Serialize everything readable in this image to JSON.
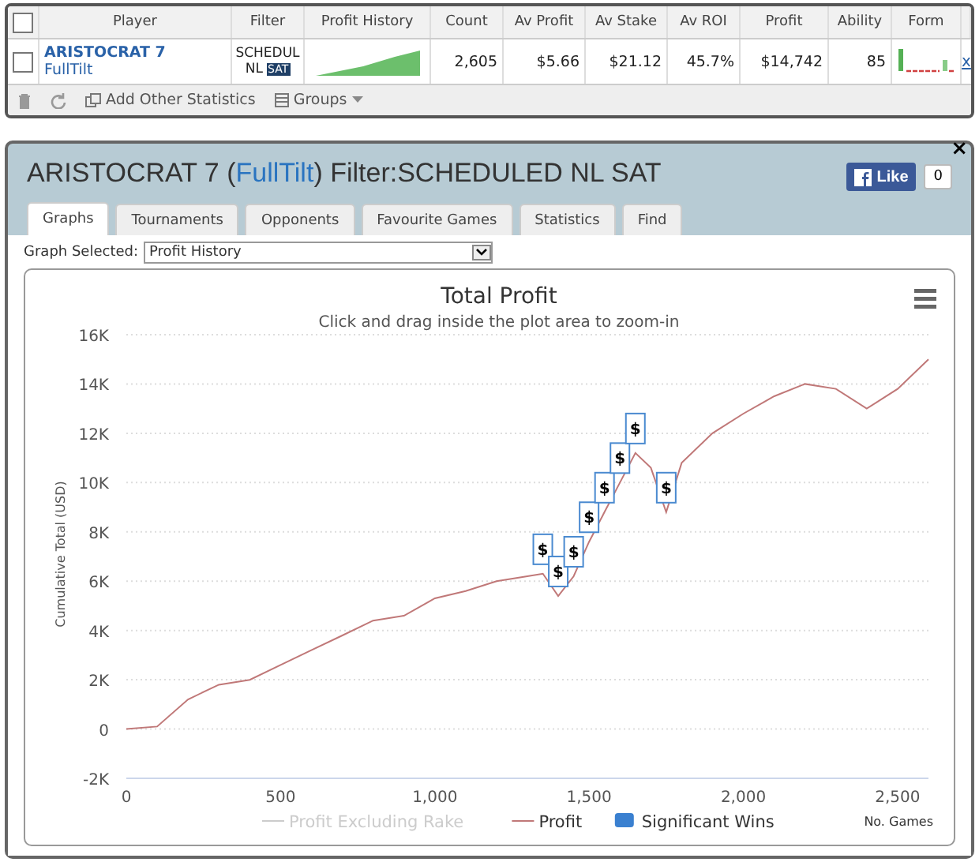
{
  "players_table": {
    "columns": [
      "Player",
      "Filter",
      "Profit History",
      "Count",
      "Av Profit",
      "Av Stake",
      "Av ROI",
      "Profit",
      "Ability",
      "Form"
    ],
    "header_checked": false,
    "rows": [
      {
        "checked": false,
        "player": "ARISTOCRAT 7",
        "site": "FullTilt",
        "filter_lines": [
          "SCHEDUL",
          "NL"
        ],
        "filter_badge": "SAT",
        "count": "2,605",
        "av_profit": "$5.66",
        "av_stake": "$21.12",
        "av_roi": "45.7%",
        "profit": "$14,742",
        "ability": "85",
        "remove": "x"
      }
    ],
    "toolbar": {
      "add_statistics": "Add Other Statistics",
      "groups": "Groups"
    }
  },
  "panel": {
    "title_before": "ARISTOCRAT 7 (",
    "title_link": "FullTilt",
    "title_after": ") Filter:SCHEDULED NL SAT",
    "like": "Like",
    "like_count": "0",
    "close": "×",
    "tabs": [
      {
        "label": "Graphs",
        "selected": true
      },
      {
        "label": "Tournaments",
        "selected": false
      },
      {
        "label": "Opponents",
        "selected": false
      },
      {
        "label": "Favourite Games",
        "selected": false
      },
      {
        "label": "Statistics",
        "selected": false
      },
      {
        "label": "Find",
        "selected": false
      }
    ],
    "graph_select": {
      "label": "Graph Selected:",
      "value": "Profit History"
    },
    "chart": {
      "legend": [
        {
          "label": "Profit Excluding Rake",
          "enabled": false,
          "kind": "line"
        },
        {
          "kind": "series",
          "enabled": true
        },
        {
          "label": "Significant Wins",
          "enabled": true,
          "kind": "flag",
          "color": "#3a80d0"
        }
      ],
      "chart_data": {
        "type": "line",
        "title": "Total Profit",
        "subtitle": "Click and drag inside the plot area to zoom-in",
        "xlabel": "No. Games",
        "ylabel": "Cumulative Total (USD)",
        "grid": true,
        "x": [
          0,
          100,
          200,
          300,
          400,
          500,
          600,
          700,
          800,
          900,
          1000,
          1100,
          1200,
          1300,
          1350,
          1400,
          1450,
          1500,
          1550,
          1600,
          1650,
          1700,
          1750,
          1800,
          1900,
          2000,
          2100,
          2200,
          2300,
          2400,
          2450,
          2500,
          2600
        ],
        "series": [
          {
            "name": "Profit",
            "color": "#c07878",
            "values": [
              0,
              100,
              1200,
              1800,
              2000,
              2600,
              3200,
              3800,
              4400,
              4600,
              5300,
              5600,
              6000,
              6200,
              6300,
              5400,
              6200,
              7600,
              8800,
              10000,
              11200,
              10600,
              8800,
              10800,
              12000,
              12800,
              13500,
              14000,
              13800,
              13000,
              13400,
              13800,
              15000
            ]
          }
        ],
        "xlim": [
          0,
          2600
        ],
        "ylim": [
          -2000,
          16000
        ],
        "xticks": [
          0,
          500,
          {
            "value": 1000,
            "label": "1,000"
          },
          {
            "value": 1500,
            "label": "1,500"
          },
          {
            "value": 2000,
            "label": "2,000"
          },
          {
            "value": 2500,
            "label": "2,500"
          }
        ],
        "yticks": [
          {
            "value": -2000,
            "label": "-2K"
          },
          0,
          {
            "value": 2000,
            "label": "2K"
          },
          {
            "value": 4000,
            "label": "4K"
          },
          {
            "value": 6000,
            "label": "6K"
          },
          {
            "value": 8000,
            "label": "8K"
          },
          {
            "value": 10000,
            "label": "10K"
          },
          {
            "value": 12000,
            "label": "12K"
          },
          {
            "value": 14000,
            "label": "14K"
          },
          {
            "value": 16000,
            "label": "16K"
          }
        ],
        "annotations": [
          {
            "x": 1350,
            "y": 6300,
            "text": "$"
          },
          {
            "x": 1400,
            "y": 5400,
            "text": "$"
          },
          {
            "x": 1450,
            "y": 6200,
            "text": "$"
          },
          {
            "x": 1500,
            "y": 7600,
            "text": "$"
          },
          {
            "x": 1550,
            "y": 8800,
            "text": "$"
          },
          {
            "x": 1600,
            "y": 10000,
            "text": "$"
          },
          {
            "x": 1650,
            "y": 11200,
            "text": "$"
          },
          {
            "x": 1750,
            "y": 8800,
            "text": "$"
          }
        ]
      }
    }
  }
}
